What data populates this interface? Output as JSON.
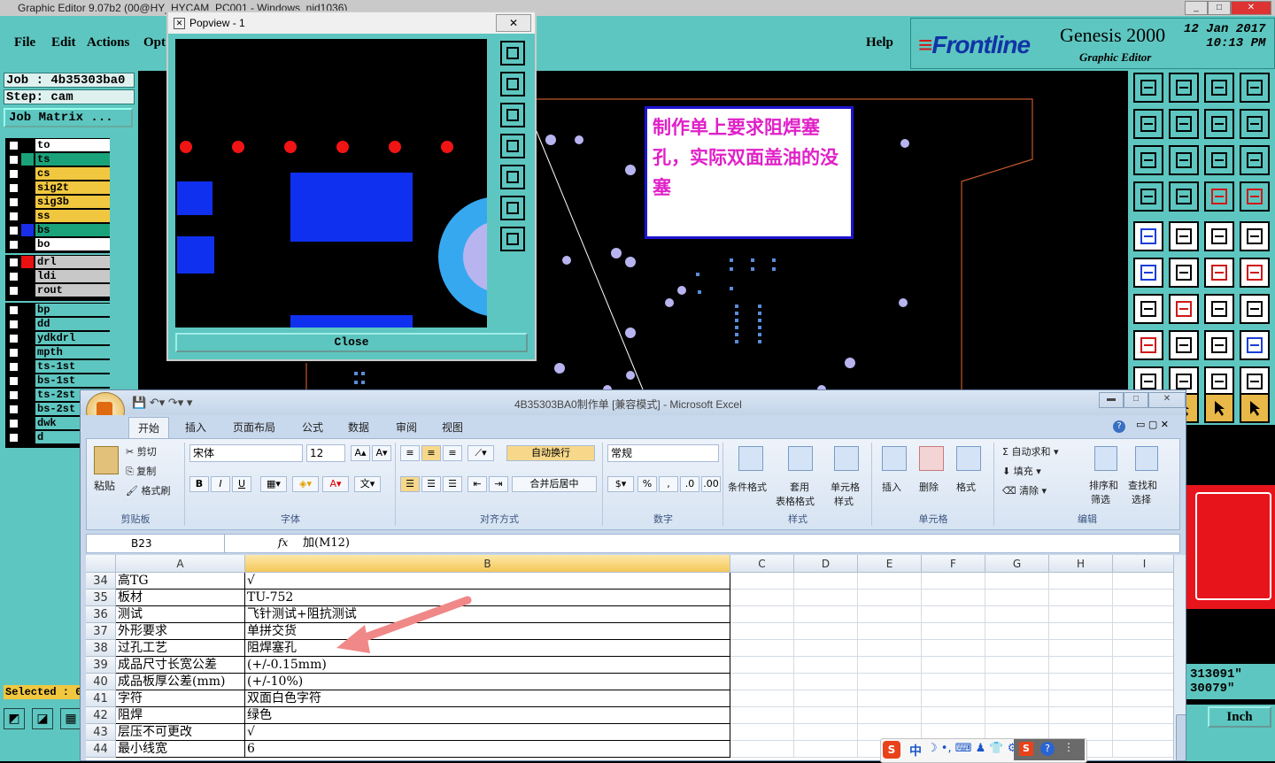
{
  "genesis": {
    "title": "Graphic Editor 9.07b2 (00@HY_HYCAM_PC001 - Windows_nid1036)",
    "menu": [
      "File",
      "Edit",
      "Actions",
      "Opt"
    ],
    "help": "Help",
    "brand": {
      "logo_text": "Frontline",
      "product": "Genesis 2000",
      "sub": "Graphic Editor",
      "date": "12 Jan 2017",
      "time": "10:13 PM"
    },
    "job": "Job : 4b35303ba0",
    "step": "Step: cam",
    "job_matrix": "Job Matrix ...",
    "layer_groups": [
      [
        {
          "name": "to",
          "swatch": "#000000",
          "bg": "#ffffff"
        },
        {
          "name": "ts",
          "swatch": "#1aa37a",
          "bg": "#1aa37a"
        },
        {
          "name": "cs",
          "swatch": "#000000",
          "bg": "#f0c73f"
        },
        {
          "name": "sig2t",
          "swatch": "#000000",
          "bg": "#f0c73f"
        },
        {
          "name": "sig3b",
          "swatch": "#000000",
          "bg": "#f0c73f"
        },
        {
          "name": "ss",
          "swatch": "#000000",
          "bg": "#f0c73f"
        },
        {
          "name": "bs",
          "swatch": "#1a2ee8",
          "bg": "#1aa37a"
        },
        {
          "name": "bo",
          "swatch": "#000000",
          "bg": "#ffffff"
        }
      ],
      [
        {
          "name": "drl",
          "swatch": "#e81010",
          "bg": "#c8c8c8"
        },
        {
          "name": "ldi",
          "swatch": "#000000",
          "bg": "#c8c8c8"
        },
        {
          "name": "rout",
          "swatch": "#000000",
          "bg": "#c8c8c8"
        }
      ],
      [
        {
          "name": "bp",
          "swatch": "#000000",
          "bg": "#5ec6c0"
        },
        {
          "name": "dd",
          "swatch": "#000000",
          "bg": "#5ec6c0"
        },
        {
          "name": "ydkdrl",
          "swatch": "#000000",
          "bg": "#5ec6c0"
        },
        {
          "name": "mpth",
          "swatch": "#000000",
          "bg": "#5ec6c0"
        },
        {
          "name": "ts-1st",
          "swatch": "#000000",
          "bg": "#5ec6c0"
        },
        {
          "name": "bs-1st",
          "swatch": "#000000",
          "bg": "#5ec6c0"
        },
        {
          "name": "ts-2st",
          "swatch": "#000000",
          "bg": "#5ec6c0"
        },
        {
          "name": "bs-2st",
          "swatch": "#000000",
          "bg": "#5ec6c0"
        },
        {
          "name": "dwk",
          "swatch": "#000000",
          "bg": "#5ec6c0"
        },
        {
          "name": "d",
          "swatch": "#000000",
          "bg": "#5ec6c0"
        }
      ]
    ],
    "selected": "Selected : 0",
    "coord1": "313091\"",
    "coord2": "30079\"",
    "units": "Inch"
  },
  "popview": {
    "title": "Popview - 1",
    "close": "Close"
  },
  "note": "制作单上要求阻焊塞孔，实际双面盖油的没塞",
  "excel": {
    "title": "4B35303BA0制作单  [兼容模式] - Microsoft Excel",
    "tabs": [
      "开始",
      "插入",
      "页面布局",
      "公式",
      "数据",
      "审阅",
      "视图"
    ],
    "clipboard": {
      "paste": "粘贴",
      "cut": "剪切",
      "copy": "复制",
      "format_painter": "格式刷",
      "label": "剪贴板"
    },
    "font": {
      "name": "宋体",
      "size": "12",
      "label": "字体"
    },
    "align": {
      "wrap": "自动换行",
      "merge": "合并后居中",
      "label": "对齐方式"
    },
    "number": {
      "format": "常规",
      "label": "数字"
    },
    "styles": {
      "cond": "条件格式",
      "table1": "套用",
      "table2": "表格格式",
      "cell1": "单元格",
      "cell2": "样式",
      "label": "样式"
    },
    "cells": {
      "insert": "插入",
      "delete": "删除",
      "format": "格式",
      "label": "单元格"
    },
    "editing": {
      "sum": "自动求和",
      "fill": "填充",
      "clear": "清除",
      "sort1": "排序和",
      "sort2": "筛选",
      "find1": "查找和",
      "find2": "选择",
      "label": "编辑"
    },
    "namebox": "B23",
    "formula": "加(M12)",
    "columns": [
      "A",
      "B",
      "C",
      "D",
      "E",
      "F",
      "G",
      "H",
      "I"
    ],
    "rows": [
      {
        "n": "34",
        "a": "高TG",
        "b": "√"
      },
      {
        "n": "35",
        "a": "板材",
        "b": "TU-752"
      },
      {
        "n": "36",
        "a": "测试",
        "b": "飞针测试+阻抗测试"
      },
      {
        "n": "37",
        "a": "外形要求",
        "b": "单拼交货"
      },
      {
        "n": "38",
        "a": "过孔工艺",
        "b": "阻焊塞孔"
      },
      {
        "n": "39",
        "a": "成品尺寸长宽公差",
        "b": "(+/-0.15mm)"
      },
      {
        "n": "40",
        "a": "成品板厚公差(mm)",
        "b": "(+/-10%)"
      },
      {
        "n": "41",
        "a": "字符",
        "b": "双面白色字符"
      },
      {
        "n": "42",
        "a": "阻焊",
        "b": "绿色"
      },
      {
        "n": "43",
        "a": "层压不可更改",
        "b": "√"
      },
      {
        "n": "44",
        "a": "最小线宽",
        "b": "6"
      }
    ]
  },
  "ime": {
    "lang": "中"
  }
}
